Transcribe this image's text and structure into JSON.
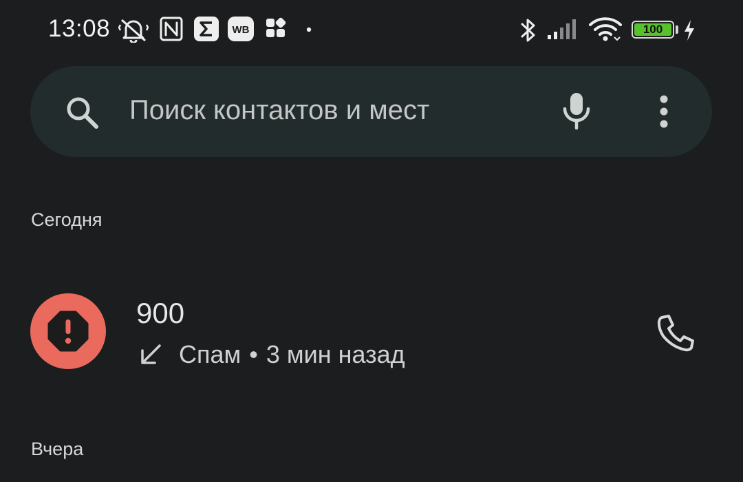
{
  "status_bar": {
    "time": "13:08",
    "battery_level": "100",
    "icons": [
      "mute-vibrate-icon",
      "nfc-icon",
      "sigma-app-icon",
      "wb-app-icon",
      "apps-grid-icon",
      "dot-icon",
      "bluetooth-icon",
      "signal-icon",
      "wifi-icon",
      "battery-icon",
      "charging-icon"
    ],
    "battery_color": "#58c12b"
  },
  "search": {
    "placeholder": "Поиск контактов и мест",
    "icons": [
      "search-icon",
      "mic-icon",
      "more-vert-icon"
    ]
  },
  "sections": {
    "today": "Сегодня",
    "yesterday": "Вчера"
  },
  "calls": [
    {
      "name": "900",
      "direction": "incoming",
      "status": "Спам",
      "separator": "•",
      "time": "3 мин назад",
      "avatar_icon": "spam-warning-icon",
      "avatar_color": "#ea6a5e",
      "action_icon": "phone-icon"
    }
  ]
}
